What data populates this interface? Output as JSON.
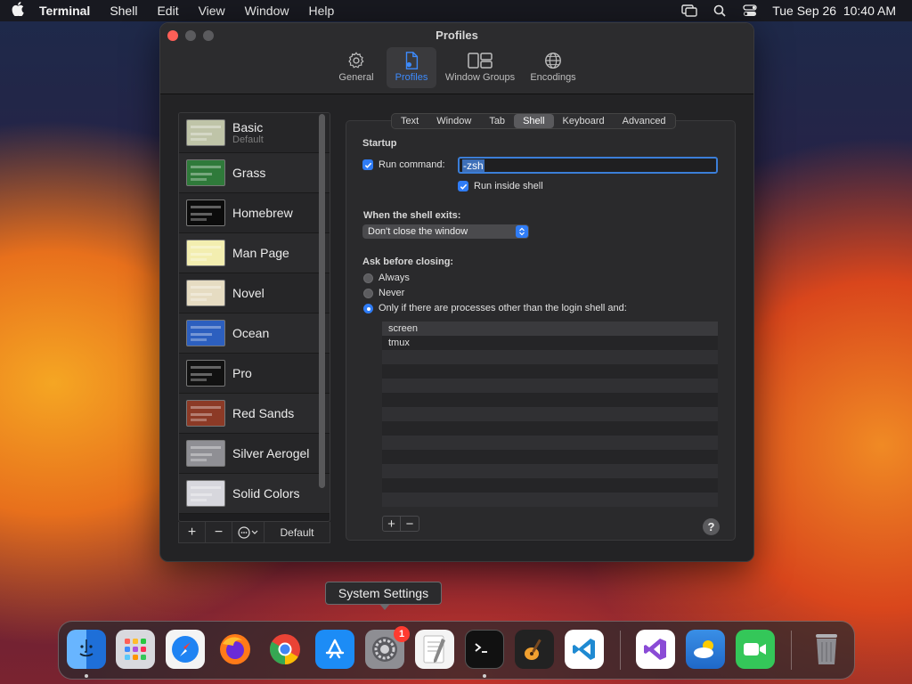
{
  "menubar": {
    "app": "Terminal",
    "items": [
      "Shell",
      "Edit",
      "View",
      "Window",
      "Help"
    ],
    "clock": "Tue Sep 26  10:40 AM"
  },
  "window": {
    "title": "Profiles",
    "toolbar": [
      {
        "label": "General",
        "icon": "gear-icon"
      },
      {
        "label": "Profiles",
        "icon": "profiles-icon"
      },
      {
        "label": "Window Groups",
        "icon": "window-groups-icon"
      },
      {
        "label": "Encodings",
        "icon": "globe-icon"
      }
    ]
  },
  "profiles": [
    {
      "name": "Basic",
      "sub": "Default",
      "color": "#bfc4a8"
    },
    {
      "name": "Grass",
      "sub": "",
      "color": "#2f7a3a"
    },
    {
      "name": "Homebrew",
      "sub": "",
      "color": "#0b0b0b"
    },
    {
      "name": "Man Page",
      "sub": "",
      "color": "#f3eeb0"
    },
    {
      "name": "Novel",
      "sub": "",
      "color": "#e6dcc2"
    },
    {
      "name": "Ocean",
      "sub": "",
      "color": "#2c5fbf"
    },
    {
      "name": "Pro",
      "sub": "",
      "color": "#111111"
    },
    {
      "name": "Red Sands",
      "sub": "",
      "color": "#8c3a26"
    },
    {
      "name": "Silver Aerogel",
      "sub": "",
      "color": "#8f8f94"
    },
    {
      "name": "Solid Colors",
      "sub": "",
      "color": "#d7d7dd"
    }
  ],
  "sidebar_footer": {
    "add": "+",
    "remove": "−",
    "default": "Default"
  },
  "tabs": [
    "Text",
    "Window",
    "Tab",
    "Shell",
    "Keyboard",
    "Advanced"
  ],
  "active_tab": "Shell",
  "startup": {
    "heading": "Startup",
    "run_command_label": "Run command:",
    "run_command_value": "-zsh",
    "run_inside_shell_label": "Run inside shell"
  },
  "shell_exit": {
    "heading": "When the shell exits:",
    "selected": "Don't close the window"
  },
  "ask_closing": {
    "heading": "Ask before closing:",
    "options": [
      "Always",
      "Never",
      "Only if there are processes other than the login shell and:"
    ],
    "processes": [
      "screen",
      "tmux"
    ]
  },
  "list_buttons": {
    "add": "+",
    "remove": "−"
  },
  "help": "?",
  "tooltip": "System Settings",
  "dock": {
    "badge": "1",
    "colors": {
      "finder": "#2b8cf0",
      "launchpad": "#d9d9de",
      "safari": "#1f83f3",
      "firefox": "#ff7a18",
      "chrome": "#ffffff",
      "appstore": "#1c8cf6",
      "settings": "#8e8e93",
      "textedit": "#f4f4f4",
      "terminal": "#111111",
      "garageband": "#222222",
      "vscode": "#ffffff",
      "visualstudio": "#ffffff",
      "weather": "#3a8fe6",
      "facetime": "#34c759",
      "trash": "#9a9a9e"
    }
  }
}
